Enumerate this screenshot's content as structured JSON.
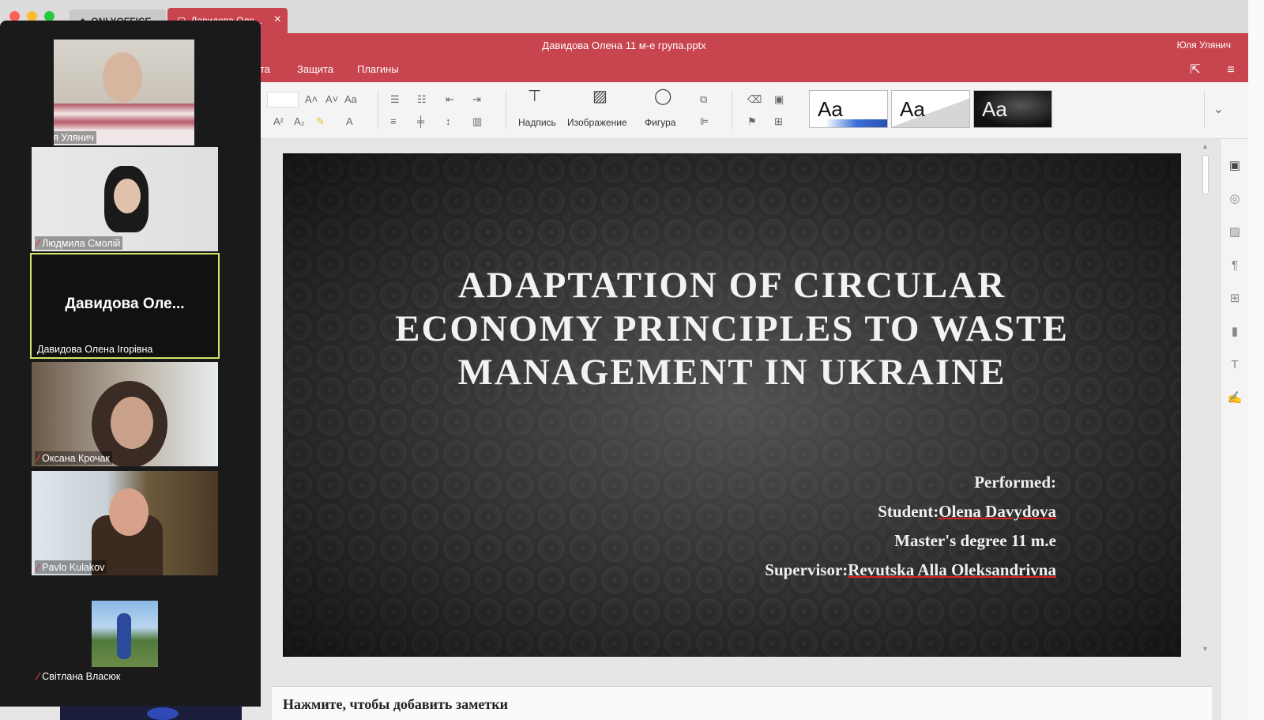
{
  "browser": {
    "tabs": [
      {
        "label": "ONLYOFFICE"
      },
      {
        "label": "Давидова Оле..."
      }
    ]
  },
  "header": {
    "document_title": "Давидова Олена 11 м-е група.pptx",
    "user": "Юля Улянич",
    "menu": [
      "ота",
      "Защита",
      "Плагины"
    ]
  },
  "toolbar": {
    "textbox_label": "Надпись",
    "image_label": "Изображение",
    "shape_label": "Фигура",
    "themes": [
      "Aa",
      "Aa",
      "Aa"
    ]
  },
  "slide": {
    "title": "ADAPTATION OF CIRCULAR ECONOMY PRINCIPLES TO WASTE MANAGEMENT IN UKRAINE",
    "performed": "Performed:",
    "student_prefix": "Student:",
    "student_name": "Olena Davydova",
    "degree": "Master's degree 11 m.e",
    "supervisor_prefix": "Supervisor:",
    "supervisor_name": "Revutska Alla Oleksandrivna"
  },
  "notes": {
    "placeholder": "Нажмите, чтобы добавить заметки"
  },
  "participants": [
    {
      "name": "Юлія Улянич",
      "muted": false
    },
    {
      "name": "Людмила Смолій",
      "muted": true
    },
    {
      "name": "Давидова Олена Ігорівна",
      "muted": false,
      "display": "Давидова  Оле...",
      "active": true
    },
    {
      "name": "Оксана Крочак",
      "muted": true
    },
    {
      "name": "Pavlo Kulakov",
      "muted": true
    },
    {
      "name": "Світлана Власюк",
      "muted": true
    }
  ],
  "colors": {
    "brand": "#c8444e",
    "active_speaker_border": "#d8e36a",
    "muted_icon": "#e43c3c"
  }
}
